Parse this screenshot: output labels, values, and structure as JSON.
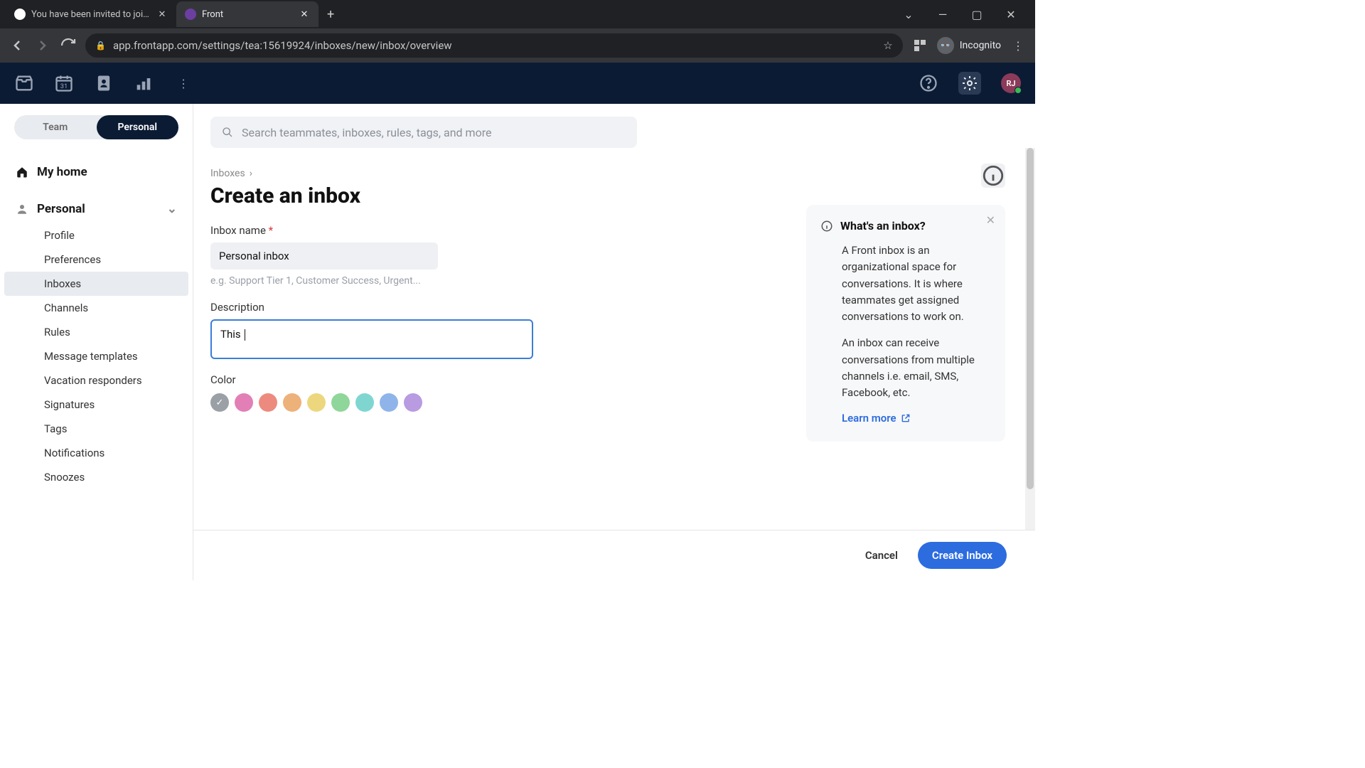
{
  "browser": {
    "tabs": [
      {
        "title": "You have been invited to join Fro",
        "active": false
      },
      {
        "title": "Front",
        "active": true
      }
    ],
    "url": "app.frontapp.com/settings/tea:15619924/inboxes/new/inbox/overview",
    "incognito_label": "Incognito"
  },
  "header": {
    "avatar_initials": "RJ"
  },
  "sidebar": {
    "toggle": {
      "team": "Team",
      "personal": "Personal"
    },
    "my_home": "My home",
    "personal_label": "Personal",
    "items": [
      "Profile",
      "Preferences",
      "Inboxes",
      "Channels",
      "Rules",
      "Message templates",
      "Vacation responders",
      "Signatures",
      "Tags",
      "Notifications",
      "Snoozes"
    ],
    "active_index": 2
  },
  "search": {
    "placeholder": "Search teammates, inboxes, rules, tags, and more"
  },
  "breadcrumb": {
    "root": "Inboxes"
  },
  "page": {
    "title": "Create an inbox"
  },
  "form": {
    "name_label": "Inbox name",
    "name_value": "Personal inbox",
    "name_hint": "e.g. Support Tier 1, Customer Success, Urgent...",
    "desc_label": "Description",
    "desc_value": "This ",
    "color_label": "Color",
    "colors": [
      "#9aa0a6",
      "#e27fb7",
      "#ed8a7f",
      "#edb17a",
      "#edd77e",
      "#8fd69a",
      "#7fd6d1",
      "#8fb4ea",
      "#b89be0"
    ],
    "selected_color": 0
  },
  "info_card": {
    "title": "What's an inbox?",
    "p1": "A Front inbox is an organizational space for conversations. It is where teammates get assigned conversations to work on.",
    "p2": "An inbox can receive conversations from multiple channels i.e. email, SMS, Facebook, etc.",
    "learn_more": "Learn more"
  },
  "footer": {
    "cancel": "Cancel",
    "create": "Create Inbox"
  }
}
